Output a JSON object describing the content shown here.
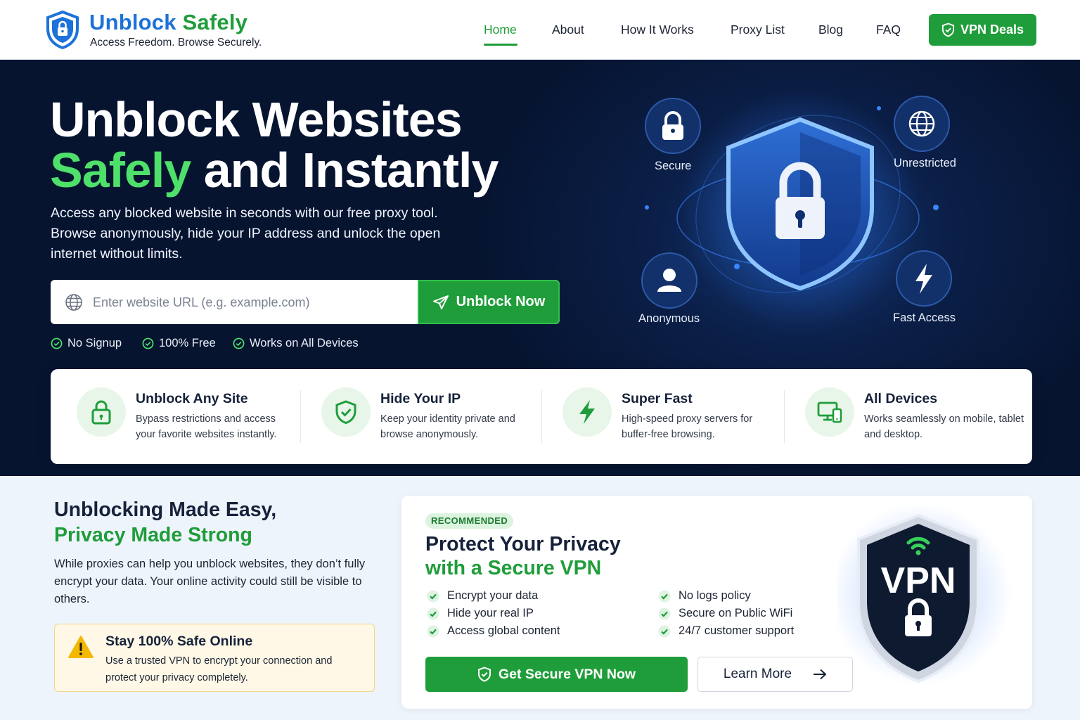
{
  "header": {
    "brand_part1": "Unblock",
    "brand_part2": "Safely",
    "tagline": "Access Freedom. Browse Securely.",
    "nav": [
      "Home",
      "About",
      "How It Works",
      "Proxy List",
      "Blog",
      "FAQ"
    ],
    "active_nav": "Home",
    "cta_label": "VPN Deals"
  },
  "hero": {
    "title_line1": "Unblock Websites",
    "title_highlight": "Safely",
    "title_line2_rest": "and Instantly",
    "description": "Access any blocked website in seconds with our free proxy tool. Browse anonymously, hide your IP address and unlock the open internet without limits.",
    "url_placeholder": "Enter website URL (e.g. example.com)",
    "unblock_label": "Unblock Now",
    "features": [
      "No Signup",
      "100% Free",
      "Works on All Devices"
    ],
    "badges": {
      "secure": "Secure",
      "unrestricted": "Unrestricted",
      "anonymous": "Anonymous",
      "fast": "Fast Access"
    }
  },
  "feature_cards": [
    {
      "title": "Unblock Any Site",
      "desc": "Bypass restrictions and access your favorite websites instantly.",
      "icon": "lock-icon"
    },
    {
      "title": "Hide Your IP",
      "desc": "Keep your identity private and browse anonymously.",
      "icon": "shield-check-icon"
    },
    {
      "title": "Super Fast",
      "desc": "High-speed proxy servers for buffer-free browsing.",
      "icon": "lightning-icon"
    },
    {
      "title": "All Devices",
      "desc": "Works seamlessly on mobile, tablet and desktop.",
      "icon": "devices-icon"
    }
  ],
  "info": {
    "title_line1": "Unblocking Made Easy,",
    "title_line2": "Privacy Made Strong",
    "description": "While proxies can help you unblock websites, they don’t fully encrypt your data. Your online activity could still be visible to others.",
    "warning_title": "Stay 100% Safe Online",
    "warning_desc": "Use a trusted VPN to encrypt your connection and protect your privacy completely."
  },
  "vpn_promo": {
    "badge": "RECOMMENDED",
    "title_line1": "Protect Your Privacy",
    "title_line2": "with a Secure VPN",
    "checks_left": [
      "Encrypt your data",
      "Hide your real IP",
      "Access global content"
    ],
    "checks_right": [
      "No logs policy",
      "Secure on Public WiFi",
      "24/7 customer support"
    ],
    "primary_label": "Get Secure VPN Now",
    "secondary_label": "Learn More",
    "art_text": "VPN"
  },
  "colors": {
    "brand_blue": "#1d72d8",
    "brand_green": "#1f9d3a",
    "hero_bg": "#061430",
    "highlight_green": "#4ee06a"
  }
}
